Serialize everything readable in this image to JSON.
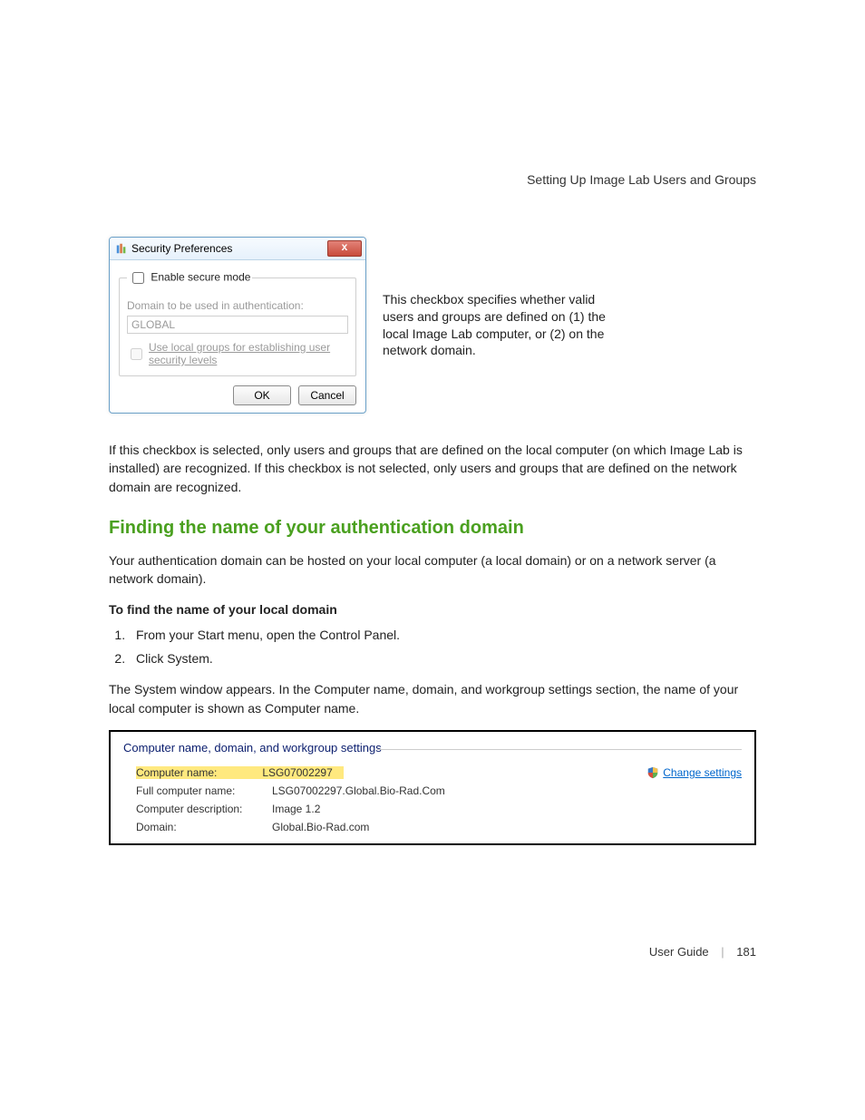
{
  "header": "Setting Up Image Lab Users and Groups",
  "dialog": {
    "title": "Security Preferences",
    "enable_label": "Enable secure mode",
    "domain_label": "Domain to be used in authentication:",
    "domain_value": "GLOBAL",
    "local_groups_label": "Use local groups for establishing user security levels",
    "ok": "OK",
    "cancel": "Cancel"
  },
  "side_note": "This checkbox specifies whether valid users and groups are defined on (1) the local Image Lab computer, or (2) on the network domain.",
  "para1": "If this checkbox is selected, only users and groups that are defined on the local computer (on which Image Lab is installed) are recognized. If this checkbox is not selected, only users and groups that are defined on the network domain are recognized.",
  "section_heading": "Finding the name of your authentication domain",
  "para2": "Your authentication domain can be hosted on your local computer (a local domain) or on a network server (a network domain).",
  "bold_line": "To find the name of your local domain",
  "steps": [
    "From your Start menu, open the Control Panel.",
    "Click System."
  ],
  "para3": "The System window appears. In the Computer name, domain, and workgroup settings section, the name of your local computer is shown as Computer name.",
  "sys_panel": {
    "title": "Computer name, domain, and workgroup settings",
    "change_link": "Change settings",
    "rows": {
      "computer_name_label": "Computer name:",
      "computer_name_value": "LSG07002297",
      "full_name_label": "Full computer name:",
      "full_name_value": "LSG07002297.Global.Bio-Rad.Com",
      "desc_label": "Computer description:",
      "desc_value": "Image 1.2",
      "domain_label": "Domain:",
      "domain_value": "Global.Bio-Rad.com"
    }
  },
  "footer": {
    "label": "User Guide",
    "page": "181"
  }
}
